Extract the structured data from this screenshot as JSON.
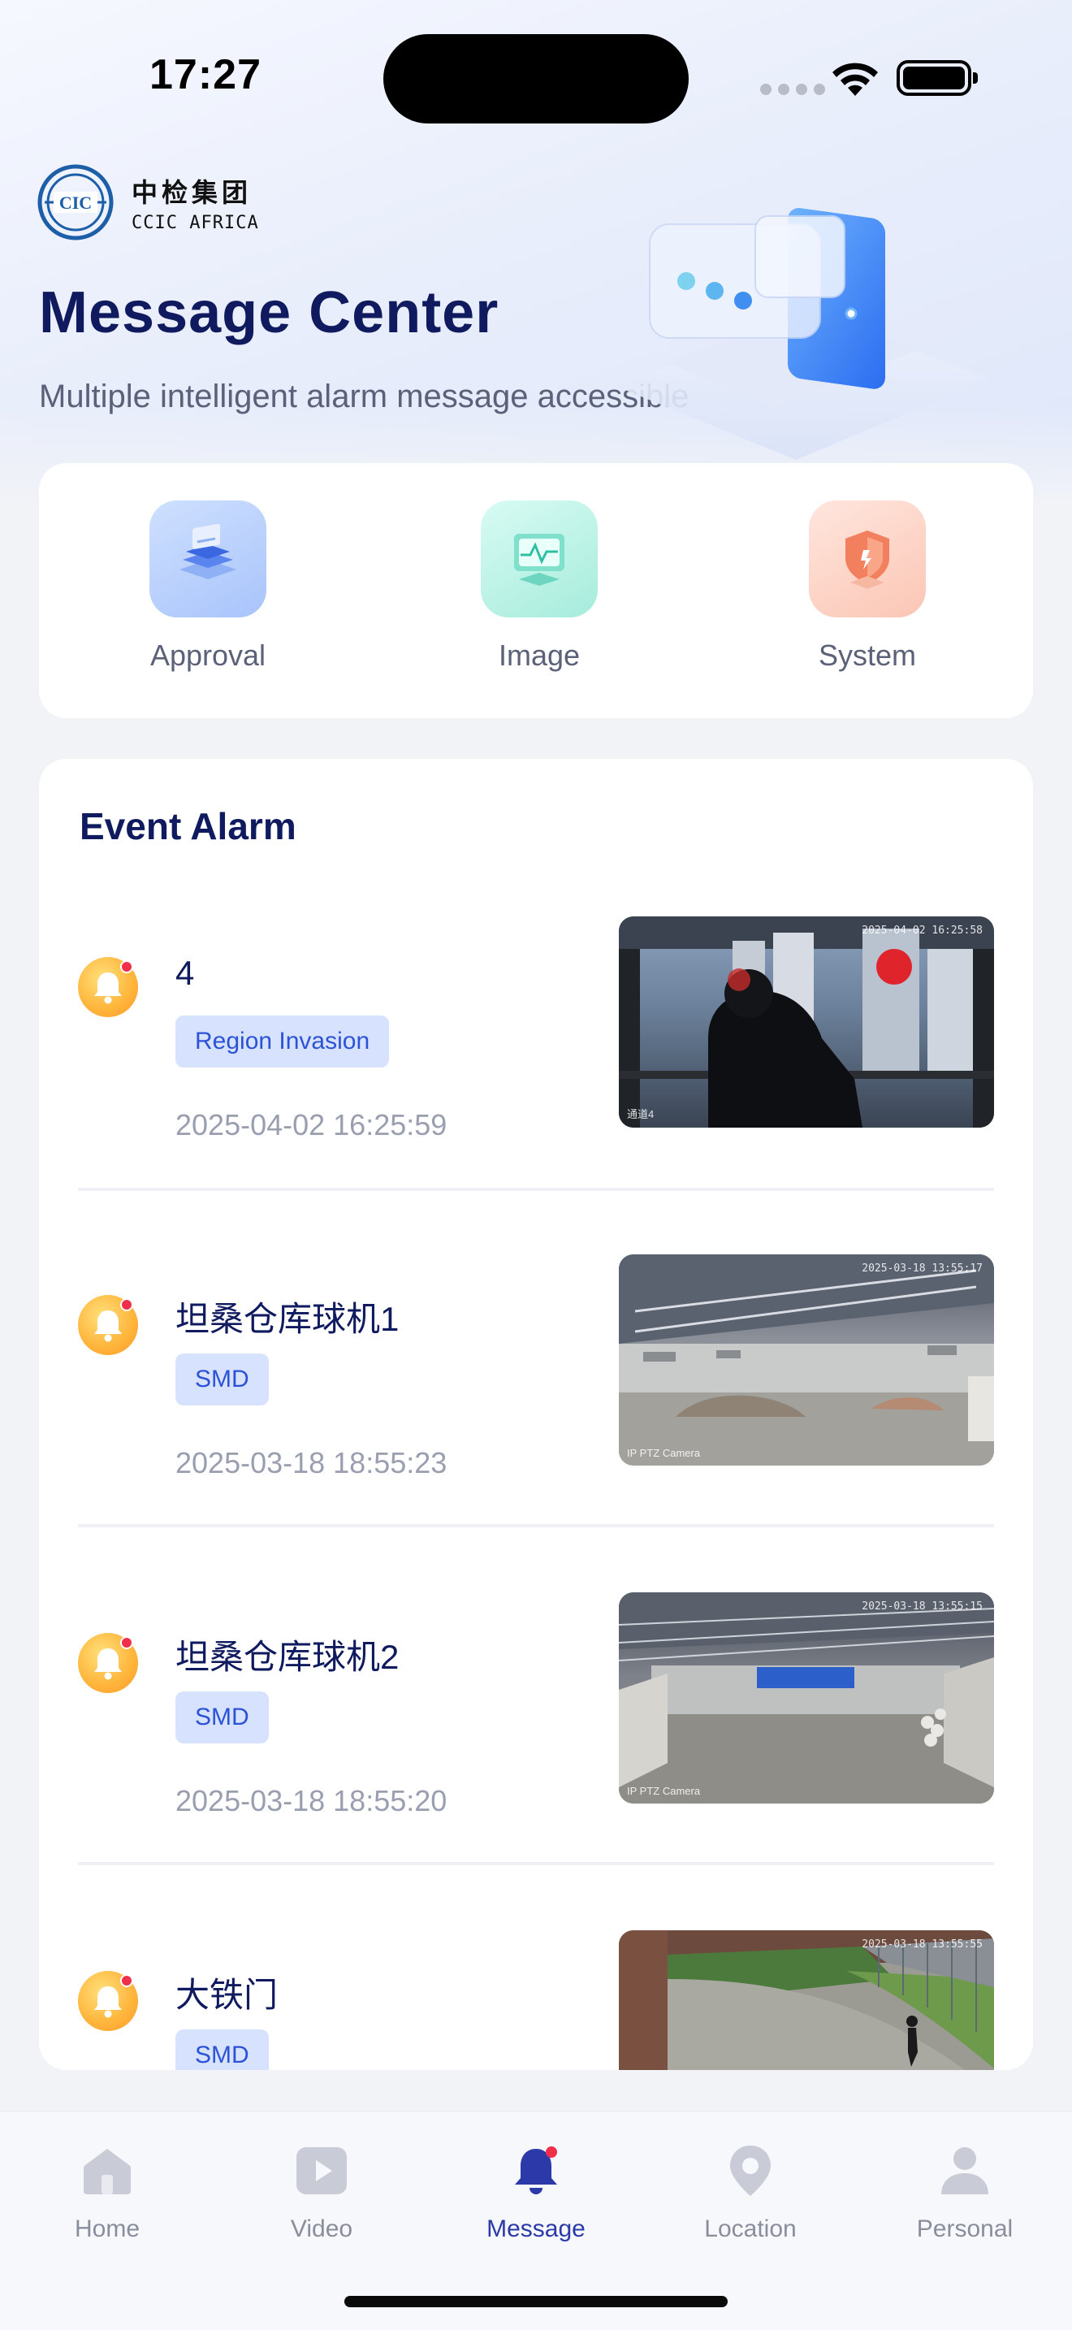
{
  "status_bar": {
    "time": "17:27"
  },
  "brand": {
    "name_cn": "中检集团",
    "name_en": "CCIC AFRICA",
    "mark_text": "CIC"
  },
  "header": {
    "title": "Message Center",
    "subtitle": "Multiple intelligent alarm message accessible"
  },
  "categories": [
    {
      "label": "Approval",
      "icon": "approval-icon",
      "color": "#7a9ef5"
    },
    {
      "label": "Image",
      "icon": "image-icon",
      "color": "#5fd3c2"
    },
    {
      "label": "System",
      "icon": "system-shield-icon",
      "color": "#f28a6a"
    }
  ],
  "event_alarm": {
    "title": "Event Alarm",
    "items": [
      {
        "name": "4",
        "tag": "Region Invasion",
        "time": "2025-04-02 16:25:59",
        "thumb_timestamp": "2025-04-02 16:25:58",
        "thumb_camera": "通道4"
      },
      {
        "name": "坦桑仓库球机1",
        "tag": "SMD",
        "time": "2025-03-18 18:55:23",
        "thumb_timestamp": "2025-03-18 13:55:17",
        "thumb_camera": "IP PTZ Camera"
      },
      {
        "name": "坦桑仓库球机2",
        "tag": "SMD",
        "time": "2025-03-18 18:55:20",
        "thumb_timestamp": "2025-03-18 13:55:15",
        "thumb_camera": "IP PTZ Camera"
      },
      {
        "name": "大铁门",
        "tag": "SMD",
        "time": "",
        "thumb_timestamp": "2025-03-18 13:55:55",
        "thumb_camera": ""
      }
    ]
  },
  "tabbar": {
    "items": [
      {
        "label": "Home",
        "icon": "home-icon"
      },
      {
        "label": "Video",
        "icon": "video-icon"
      },
      {
        "label": "Message",
        "icon": "bell-icon",
        "active": true
      },
      {
        "label": "Location",
        "icon": "location-pin-icon"
      },
      {
        "label": "Personal",
        "icon": "person-icon"
      }
    ],
    "active_color": "#2b3aa8",
    "inactive_color": "#c9ccd6"
  }
}
